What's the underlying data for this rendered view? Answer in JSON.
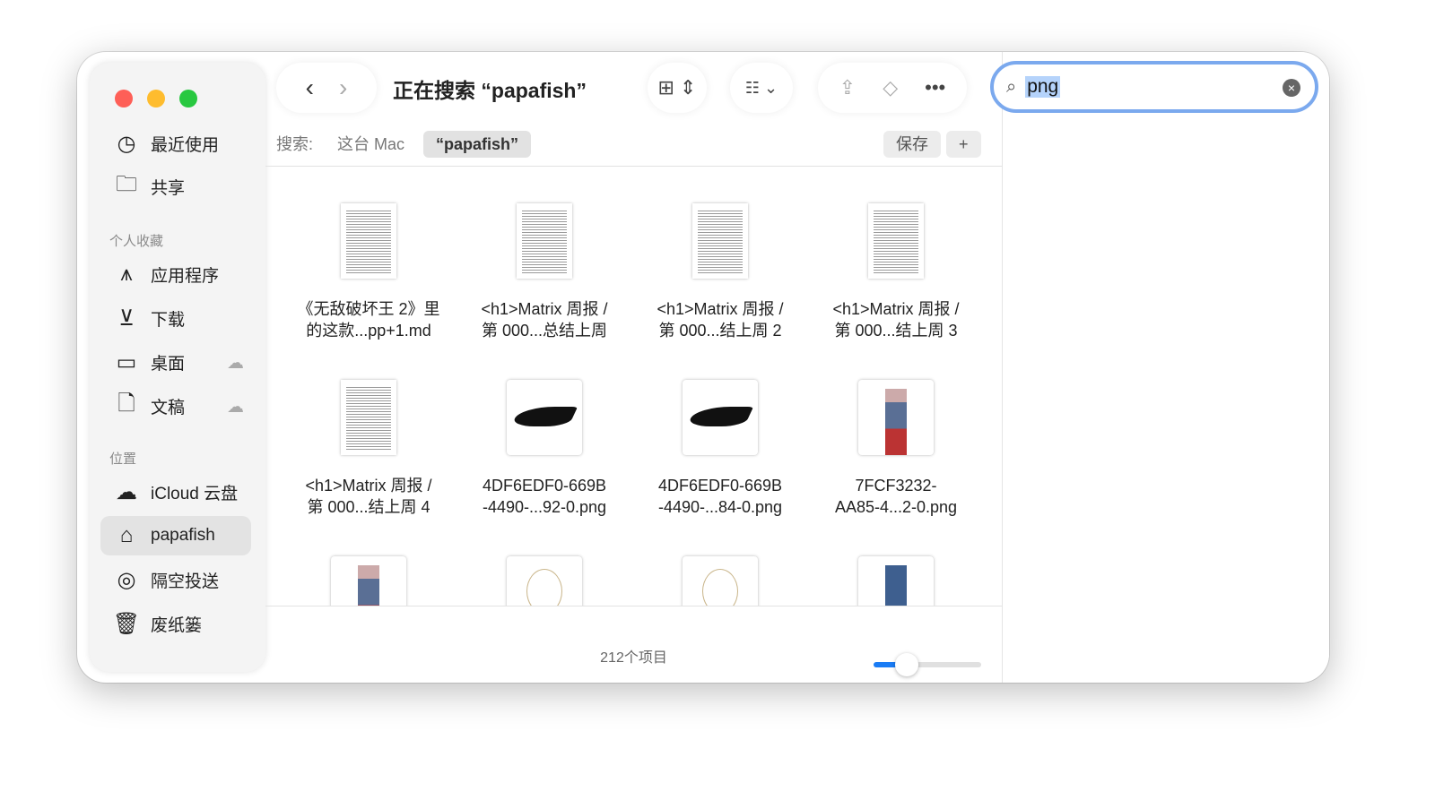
{
  "window": {
    "title": "正在搜索 “papafish”",
    "traffic_colors": [
      "#fe5f57",
      "#febc2e",
      "#28c840"
    ]
  },
  "sidebar": {
    "items": [
      {
        "label": "最近使用",
        "icon": "clock-icon"
      },
      {
        "label": "共享",
        "icon": "shared-folder-icon"
      }
    ],
    "favorites_header": "个人收藏",
    "favorites": [
      {
        "label": "应用程序",
        "icon": "apps-icon"
      },
      {
        "label": "下载",
        "icon": "download-icon"
      },
      {
        "label": "桌面",
        "icon": "desktop-icon",
        "cloud": true
      },
      {
        "label": "文稿",
        "icon": "document-icon",
        "cloud": true
      }
    ],
    "locations_header": "位置",
    "locations": [
      {
        "label": "iCloud 云盘",
        "icon": "cloud-icon"
      },
      {
        "label": "papafish",
        "icon": "home-icon",
        "selected": true
      },
      {
        "label": "隔空投送",
        "icon": "airdrop-icon"
      },
      {
        "label": "废纸篓",
        "icon": "trash-icon"
      }
    ]
  },
  "scope": {
    "label": "搜索:",
    "this_mac": "这台 Mac",
    "folder": "“papafish”",
    "save": "保存",
    "add": "+"
  },
  "search": {
    "value": "png"
  },
  "files": [
    {
      "name1": "《无敌破坏王 2》里",
      "name2": "的这款...pp+1.md",
      "kind": "doc"
    },
    {
      "name1": "<h1>Matrix 周报 /",
      "name2": "第 000...总结上周",
      "kind": "doc"
    },
    {
      "name1": "<h1>Matrix 周报 /",
      "name2": "第 000...结上周 2",
      "kind": "doc"
    },
    {
      "name1": "<h1>Matrix 周报 /",
      "name2": "第 000...结上周 3",
      "kind": "doc"
    },
    {
      "name1": "<h1>Matrix 周报 /",
      "name2": "第 000...结上周 4",
      "kind": "doc"
    },
    {
      "name1": "4DF6EDF0-669B",
      "name2": "-4490-...92-0.png",
      "kind": "shoe"
    },
    {
      "name1": "4DF6EDF0-669B",
      "name2": "-4490-...84-0.png",
      "kind": "shoe"
    },
    {
      "name1": "7FCF3232-",
      "name2": "AA85-4...2-0.png",
      "kind": "person"
    },
    {
      "name1": "",
      "name2": "",
      "kind": "person"
    },
    {
      "name1": "",
      "name2": "",
      "kind": "necklace"
    },
    {
      "name1": "",
      "name2": "",
      "kind": "necklace"
    },
    {
      "name1": "",
      "name2": "",
      "kind": "jeans"
    }
  ],
  "status": {
    "count": "212个项目",
    "icon_size_percent": 25
  },
  "accent": "#1a7cf5"
}
